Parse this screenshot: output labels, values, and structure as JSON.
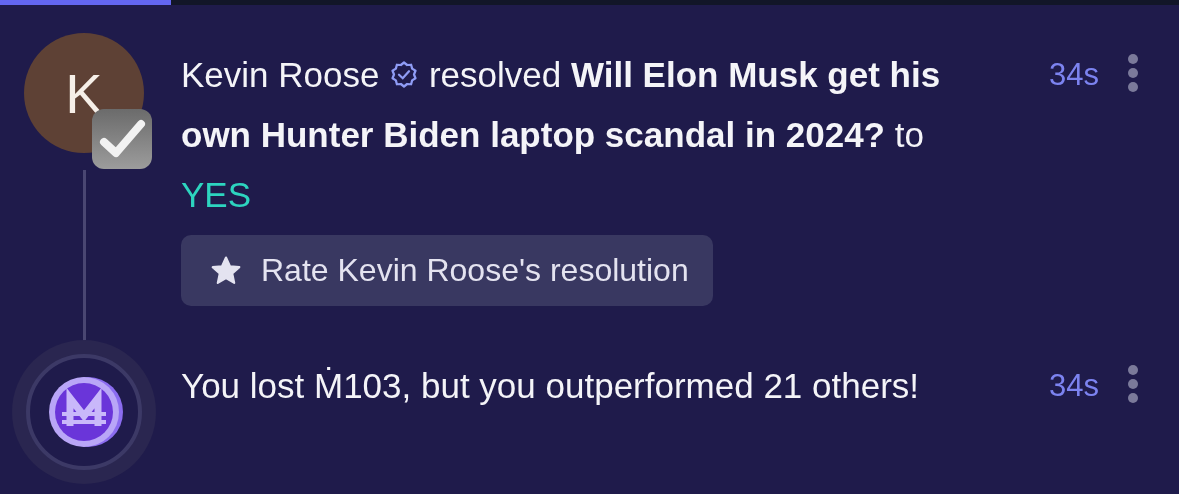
{
  "progress": {
    "level": 0.145
  },
  "notifications": [
    {
      "kind": "resolution",
      "avatar_letter": "K",
      "author": "Kevin Roose",
      "verified": true,
      "text": "resolved **Will Elon Musk get his own Hunter Biden laptop scandal in 2024?** to",
      "outcome": "YES",
      "time": "34s",
      "action": "Rate Kevin Roose's resolution"
    },
    {
      "kind": "loss",
      "text": "You lost Ṁ103, but you outperformed 21 others!",
      "time": "34s"
    }
  ]
}
